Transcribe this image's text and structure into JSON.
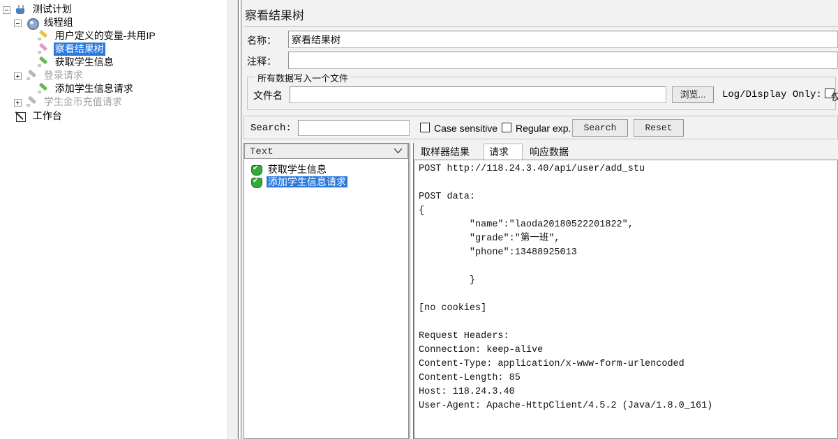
{
  "app": {
    "tree": {
      "items": [
        {
          "label": "测试计划",
          "icon": "flask-icon",
          "indent": 0,
          "handle": "minus",
          "state": "normal"
        },
        {
          "label": "线程组",
          "icon": "gear-icon",
          "indent": 1,
          "handle": "minus",
          "state": "normal"
        },
        {
          "label": "用户定义的变量-共用IP",
          "icon": "config-element-icon",
          "indent": 2,
          "handle": "none",
          "state": "normal"
        },
        {
          "label": "察看结果树",
          "icon": "listener-icon",
          "indent": 2,
          "handle": "none",
          "state": "selected"
        },
        {
          "label": "获取学生信息",
          "icon": "sampler-icon",
          "indent": 2,
          "handle": "none",
          "state": "normal"
        },
        {
          "label": "登录请求",
          "icon": "sampler-icon",
          "indent": 2,
          "handle": "plus",
          "state": "disabled"
        },
        {
          "label": "添加学生信息请求",
          "icon": "sampler-icon",
          "indent": 2,
          "handle": "none",
          "state": "normal"
        },
        {
          "label": "学生金币充值请求",
          "icon": "sampler-icon",
          "indent": 2,
          "handle": "plus",
          "state": "disabled"
        },
        {
          "label": "工作台",
          "icon": "workbench-icon",
          "indent": 0,
          "handle": "none",
          "state": "normal"
        }
      ]
    },
    "panel": {
      "title": "察看结果树",
      "name_label": "名称：",
      "name_value": "察看结果树",
      "comment_label": "注释：",
      "comment_value": "",
      "filegroup": {
        "title": "所有数据写入一个文件",
        "filename_label": "文件名",
        "filename_value": "",
        "browse_button": "浏览...",
        "logdisplay_label": "Log/Display Only:",
        "errors_label_partial": "仅"
      },
      "search": {
        "label": "Search:",
        "value": "",
        "case_sensitive_label": "Case sensitive",
        "regular_exp_label": "Regular exp.",
        "search_button": "Search",
        "reset_button": "Reset"
      },
      "results": {
        "render_selected": "Text",
        "items": [
          {
            "label": "获取学生信息",
            "status": "success",
            "state": "normal"
          },
          {
            "label": "添加学生信息请求",
            "status": "success",
            "state": "selected"
          }
        ]
      },
      "tabs": [
        {
          "label": "取样器结果",
          "active": false
        },
        {
          "label": "请求",
          "active": true
        },
        {
          "label": "响应数据",
          "active": false
        }
      ],
      "request_text": "POST http://118.24.3.40/api/user/add_stu\n\nPOST data:\n{\n         \"name\":\"laoda20180522201822\",\n         \"grade\":\"第一班\",\n         \"phone\":13488925013\n\n         }\n\n[no cookies]\n\nRequest Headers:\nConnection: keep-alive\nContent-Type: application/x-www-form-urlencoded\nContent-Length: 85\nHost: 118.24.3.40\nUser-Agent: Apache-HttpClient/4.5.2 (Java/1.8.0_161)"
    },
    "colors": {
      "selection_blue": "#2a7ade",
      "success_green": "#37a93a",
      "panel_bg": "#f2f2f2"
    }
  }
}
